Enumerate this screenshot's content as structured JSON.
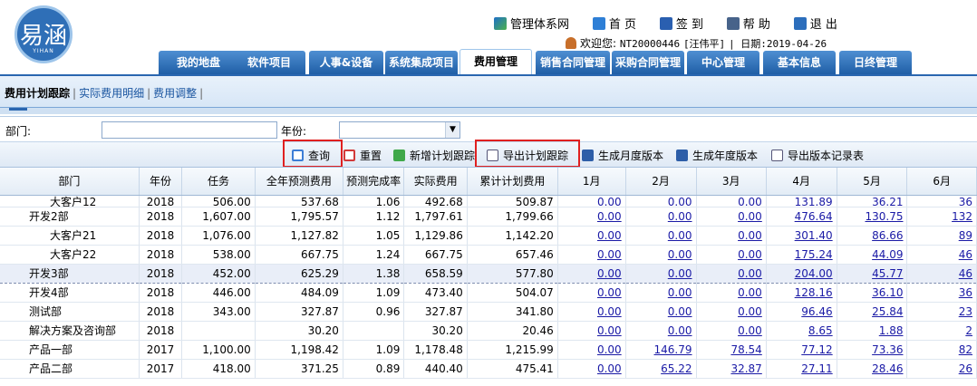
{
  "header": {
    "logo_text": "易涵",
    "logo_sub": "YIHAN",
    "toplinks": [
      {
        "label": "管理体系网",
        "icon": "network-icon"
      },
      {
        "label": "首 页",
        "icon": "home-icon"
      },
      {
        "label": "签 到",
        "icon": "checkin-icon"
      },
      {
        "label": "帮 助",
        "icon": "help-icon"
      },
      {
        "label": "退 出",
        "icon": "exit-icon"
      }
    ],
    "welcome_label": "欢迎您:",
    "user_id": "NT20000446",
    "user_name": "[汪伟平]",
    "date_label": "| 日期:",
    "date": "2019-04-26"
  },
  "nav": {
    "tabs": [
      "我的地盘",
      "软件项目",
      "人事&设备",
      "系统集成项目",
      "费用管理",
      "销售合同管理",
      "采购合同管理",
      "中心管理",
      "基本信息",
      "日终管理"
    ],
    "active_index": 4
  },
  "subnav": {
    "items": [
      "费用计划跟踪",
      "实际费用明细",
      "费用调整"
    ],
    "active_index": 0
  },
  "filter": {
    "dept_label": "部门:",
    "dept_value": "",
    "year_label": "年份:",
    "year_value": ""
  },
  "toolbar": {
    "query": "查询",
    "reset": "重置",
    "add_plan": "新增计划跟踪",
    "export_plan": "导出计划跟踪",
    "gen_month": "生成月度版本",
    "gen_year": "生成年度版本",
    "export_version": "导出版本记录表"
  },
  "table": {
    "columns": [
      "部门",
      "年份",
      "任务",
      "全年预测费用",
      "预测完成率",
      "实际费用",
      "累计计划费用",
      "1月",
      "2月",
      "3月",
      "4月",
      "5月",
      "6月"
    ],
    "rows": [
      {
        "dept": "大客户12",
        "indent": true,
        "year": "2018",
        "task": "506.00",
        "forecast": "537.68",
        "rate": "1.06",
        "actual": "492.68",
        "cum": "509.87",
        "m1": "0.00",
        "m2": "0.00",
        "m3": "0.00",
        "m4": "131.89",
        "m5": "36.21",
        "m6": "36"
      },
      {
        "dept": "开发2部",
        "indent": false,
        "year": "2018",
        "task": "1,607.00",
        "forecast": "1,795.57",
        "rate": "1.12",
        "actual": "1,797.61",
        "cum": "1,799.66",
        "m1": "0.00",
        "m2": "0.00",
        "m3": "0.00",
        "m4": "476.64",
        "m5": "130.75",
        "m6": "132"
      },
      {
        "dept": "大客户21",
        "indent": true,
        "year": "2018",
        "task": "1,076.00",
        "forecast": "1,127.82",
        "rate": "1.05",
        "actual": "1,129.86",
        "cum": "1,142.20",
        "m1": "0.00",
        "m2": "0.00",
        "m3": "0.00",
        "m4": "301.40",
        "m5": "86.66",
        "m6": "89"
      },
      {
        "dept": "大客户22",
        "indent": true,
        "year": "2018",
        "task": "538.00",
        "forecast": "667.75",
        "rate": "1.24",
        "actual": "667.75",
        "cum": "657.46",
        "m1": "0.00",
        "m2": "0.00",
        "m3": "0.00",
        "m4": "175.24",
        "m5": "44.09",
        "m6": "46"
      },
      {
        "dept": "开发3部",
        "indent": false,
        "selected": true,
        "year": "2018",
        "task": "452.00",
        "forecast": "625.29",
        "rate": "1.38",
        "actual": "658.59",
        "cum": "577.80",
        "m1": "0.00",
        "m2": "0.00",
        "m3": "0.00",
        "m4": "204.00",
        "m5": "45.77",
        "m6": "46"
      },
      {
        "dept": "开发4部",
        "indent": false,
        "year": "2018",
        "task": "446.00",
        "forecast": "484.09",
        "rate": "1.09",
        "actual": "473.40",
        "cum": "504.07",
        "m1": "0.00",
        "m2": "0.00",
        "m3": "0.00",
        "m4": "128.16",
        "m5": "36.10",
        "m6": "36"
      },
      {
        "dept": "测试部",
        "indent": false,
        "year": "2018",
        "task": "343.00",
        "forecast": "327.87",
        "rate": "0.96",
        "actual": "327.87",
        "cum": "341.80",
        "m1": "0.00",
        "m2": "0.00",
        "m3": "0.00",
        "m4": "96.46",
        "m5": "25.84",
        "m6": "23"
      },
      {
        "dept": "解决方案及咨询部",
        "indent": false,
        "year": "2018",
        "task": "",
        "forecast": "30.20",
        "rate": "",
        "actual": "30.20",
        "cum": "20.46",
        "m1": "0.00",
        "m2": "0.00",
        "m3": "0.00",
        "m4": "8.65",
        "m5": "1.88",
        "m6": "2"
      },
      {
        "dept": "产品一部",
        "indent": false,
        "year": "2017",
        "task": "1,100.00",
        "forecast": "1,198.42",
        "rate": "1.09",
        "actual": "1,178.48",
        "cum": "1,215.99",
        "m1": "0.00",
        "m2": "146.79",
        "m3": "78.54",
        "m4": "77.12",
        "m5": "73.36",
        "m6": "82"
      },
      {
        "dept": "产品二部",
        "indent": false,
        "year": "2017",
        "task": "418.00",
        "forecast": "371.25",
        "rate": "0.89",
        "actual": "440.40",
        "cum": "475.41",
        "m1": "0.00",
        "m2": "65.22",
        "m3": "32.87",
        "m4": "27.11",
        "m5": "28.46",
        "m6": "26"
      }
    ]
  },
  "colors": {
    "nav_blue": "#1f5ea6",
    "highlight_red": "#e02020",
    "link_blue": "#1a1aa6"
  }
}
